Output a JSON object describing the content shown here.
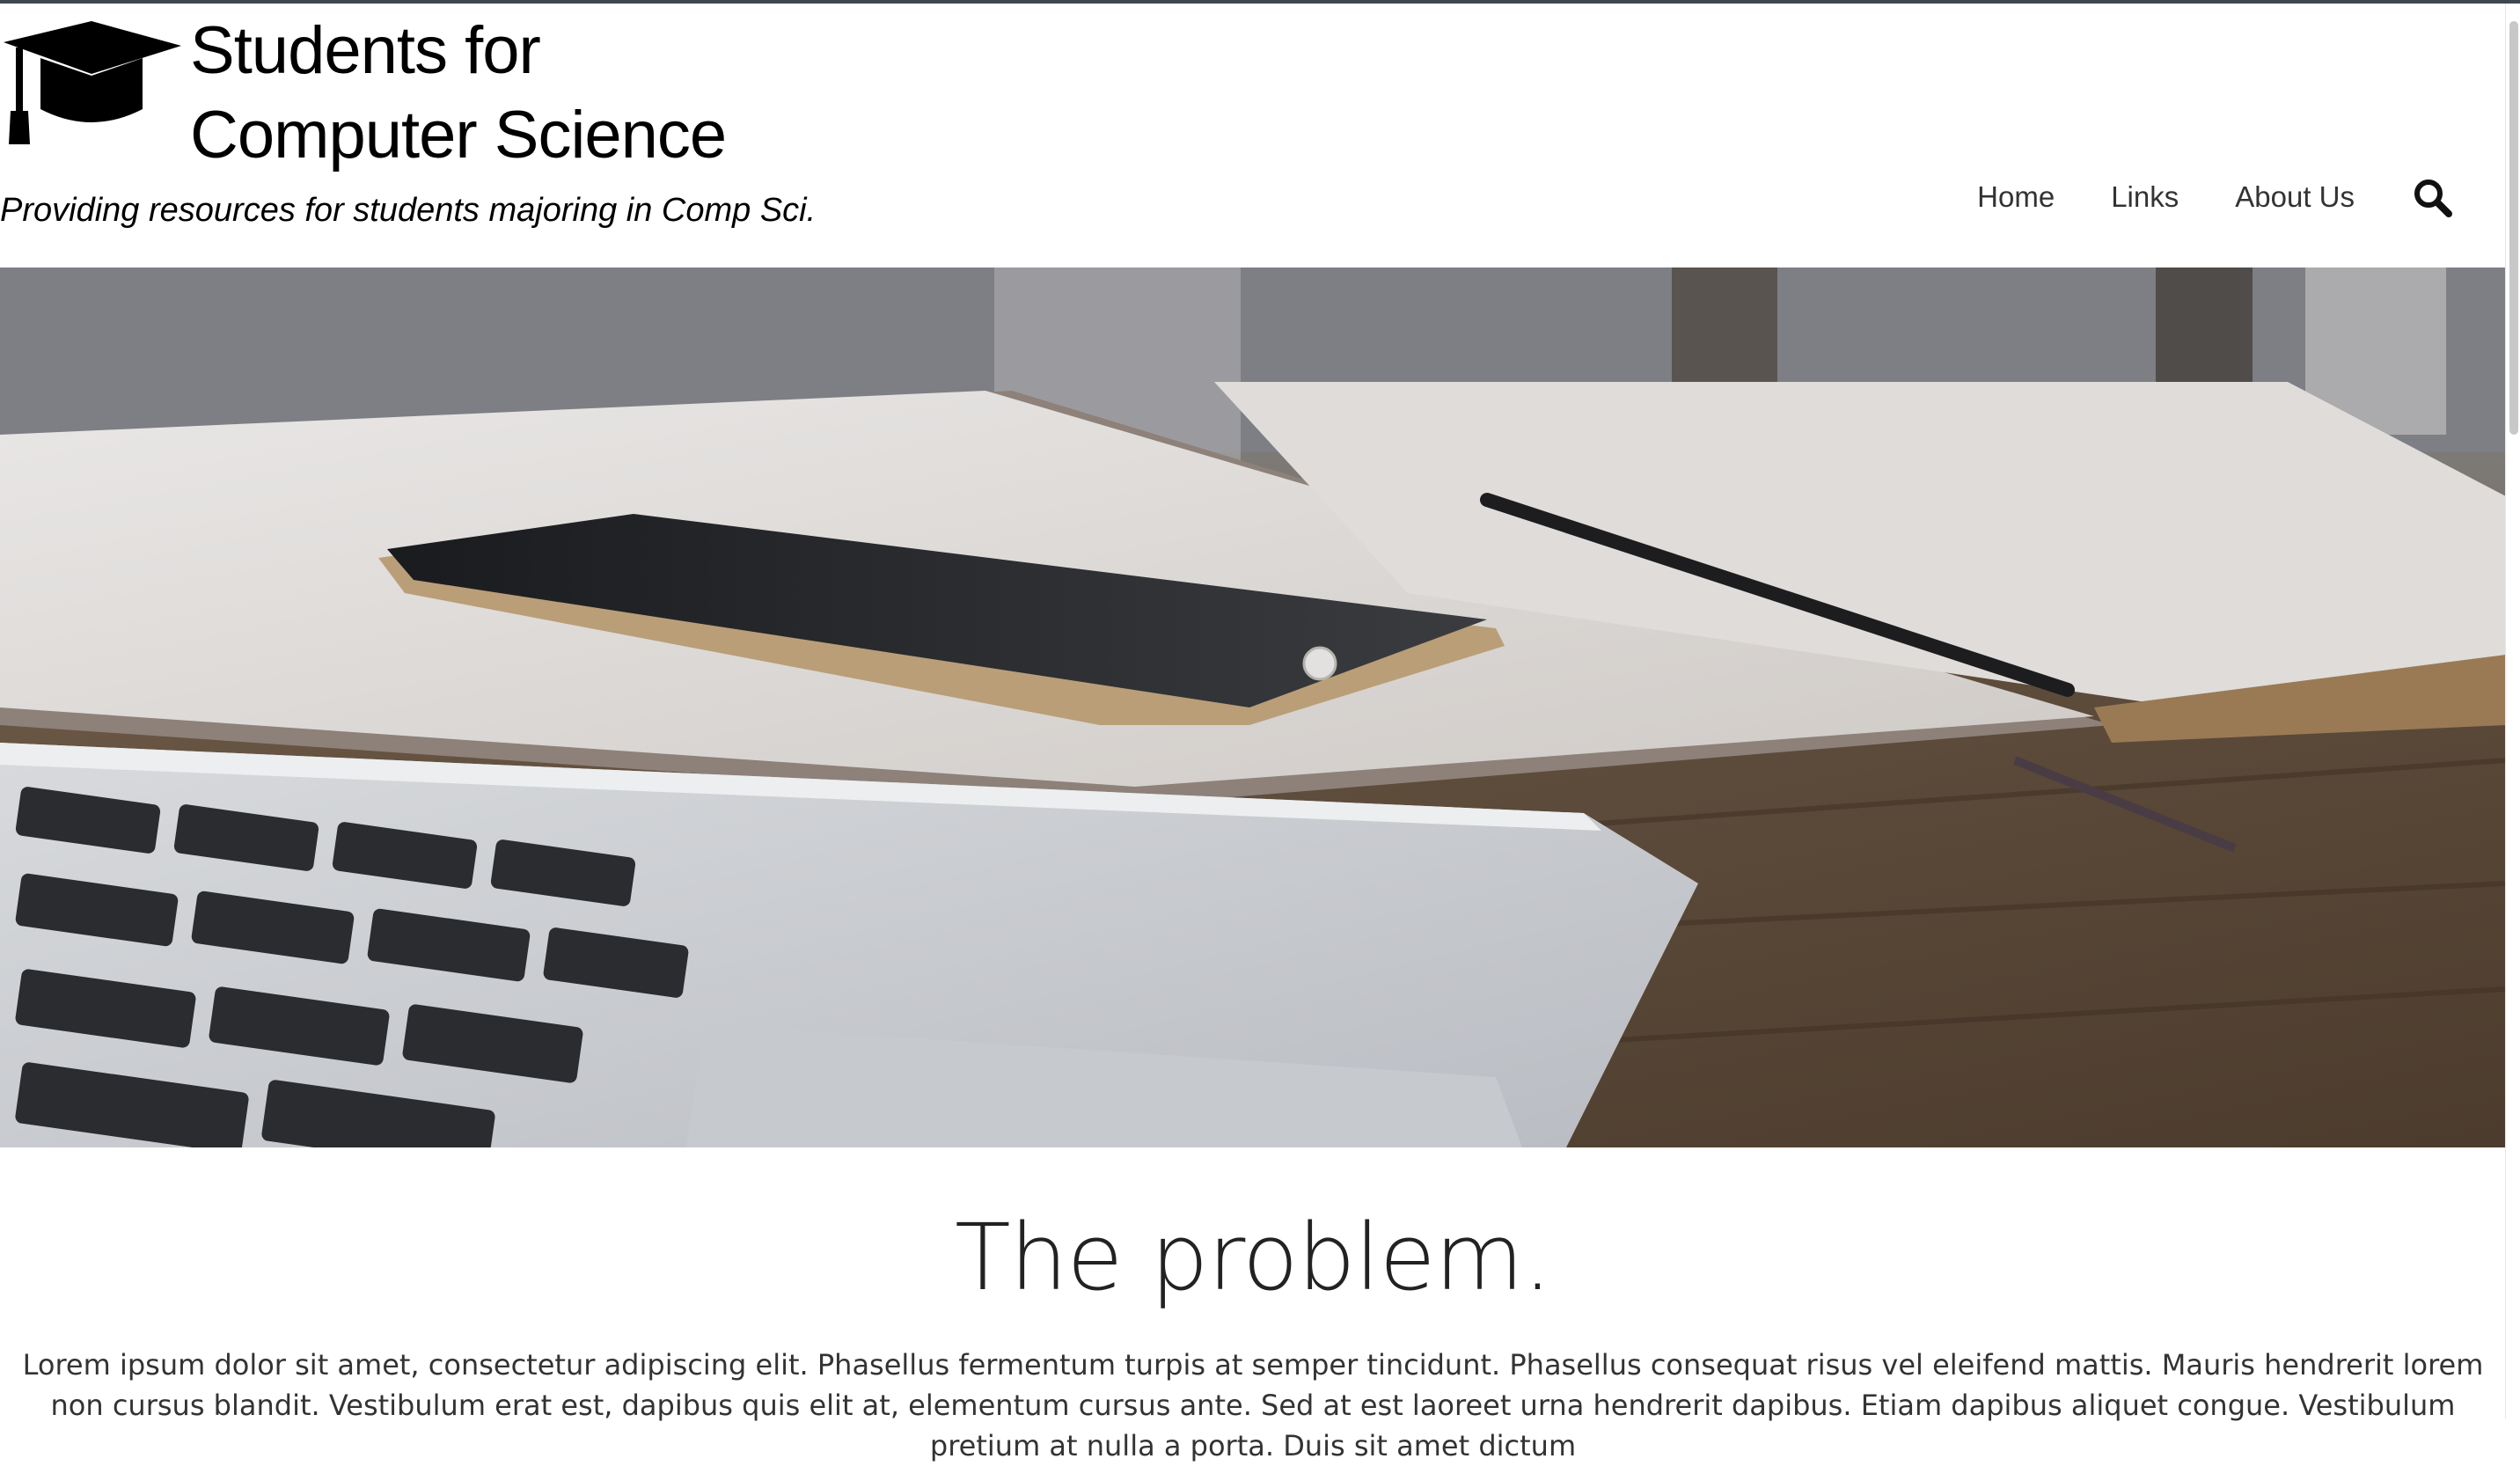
{
  "site": {
    "title_line1": "Students for",
    "title_line2": "Computer Science",
    "tagline": "Providing resources for students majoring in Comp Sci."
  },
  "nav": {
    "items": [
      {
        "label": "Home"
      },
      {
        "label": "Links"
      },
      {
        "label": "About Us"
      }
    ],
    "search_icon": "search-icon"
  },
  "hero": {
    "image": "desk-with-laptop-phone-notebook"
  },
  "section": {
    "heading": "The problem.",
    "body": "Lorem ipsum dolor sit amet, consectetur adipiscing elit. Phasellus fermentum turpis at semper tincidunt. Phasellus consequat risus vel eleifend mattis. Mauris hendrerit lorem non cursus blandit. Vestibulum erat est, dapibus quis elit at, elementum cursus ante. Sed at est laoreet urna hendrerit dapibus. Etiam dapibus aliquet congue. Vestibulum pretium at nulla a porta. Duis sit amet dictum"
  },
  "colors": {
    "top_border": "#3d4650",
    "nav_text": "#333333",
    "heading": "#222222"
  }
}
